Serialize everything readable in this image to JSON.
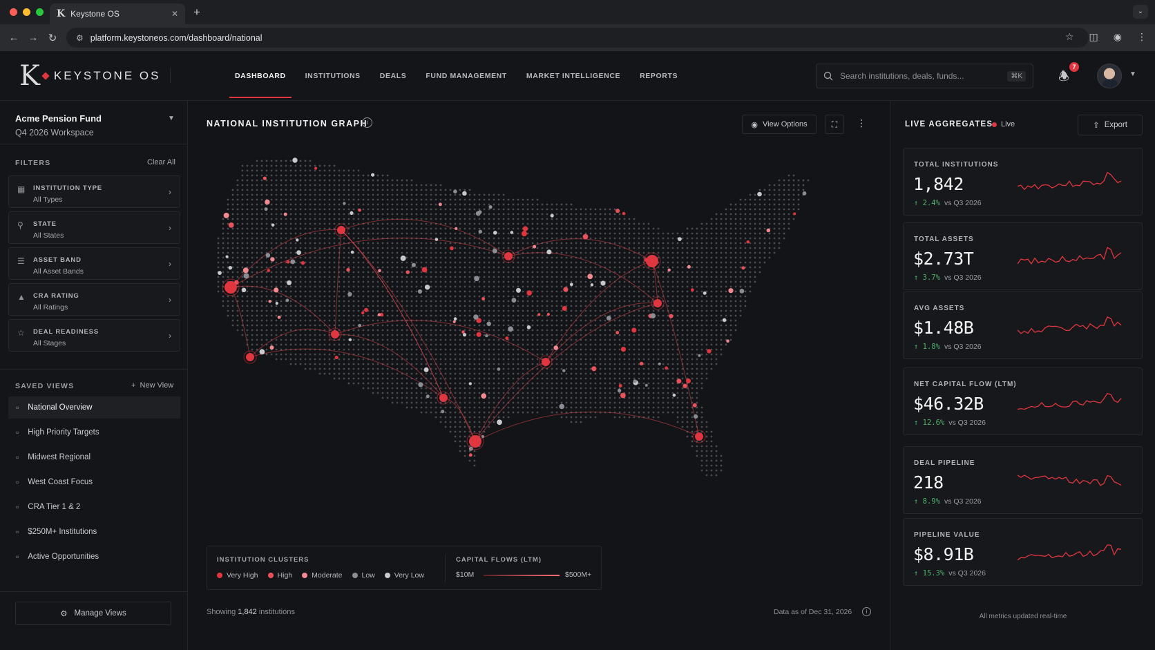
{
  "browser": {
    "tab_title": "Keystone OS",
    "tab_logo": "K",
    "tab_close": "✕",
    "new_tab": "+",
    "url": "platform.keystoneos.com/dashboard/national"
  },
  "header": {
    "logo_mark": "K",
    "brand": "KEYSTONE OS",
    "nav": [
      {
        "label": "DASHBOARD",
        "active": true
      },
      {
        "label": "INSTITUTIONS"
      },
      {
        "label": "DEALS"
      },
      {
        "label": "FUND MANAGEMENT"
      },
      {
        "label": "MARKET INTELLIGENCE"
      },
      {
        "label": "REPORTS"
      }
    ],
    "search_placeholder": "Search institutions, deals, funds...",
    "search_shortcut": "⌘K",
    "notification_count": "7"
  },
  "sidebar": {
    "workspace_name": "Acme Pension Fund",
    "workspace_sub": "Q4 2026 Workspace",
    "filters_title": "FILTERS",
    "clear_all": "Clear All",
    "filters": [
      {
        "label": "INSTITUTION TYPE",
        "value": "All Types",
        "icon": "building-icon"
      },
      {
        "label": "STATE",
        "value": "All States",
        "icon": "pin-icon"
      },
      {
        "label": "ASSET BAND",
        "value": "All Asset Bands",
        "icon": "list-icon"
      },
      {
        "label": "CRA RATING",
        "value": "All Ratings",
        "icon": "badge-icon"
      },
      {
        "label": "DEAL READINESS",
        "value": "All Stages",
        "icon": "star-icon"
      }
    ],
    "saved_title": "SAVED VIEWS",
    "new_view": "New View",
    "views": [
      {
        "label": "National Overview",
        "active": true
      },
      {
        "label": "High Priority Targets"
      },
      {
        "label": "Midwest Regional"
      },
      {
        "label": "West Coast Focus"
      },
      {
        "label": "CRA Tier 1 & 2"
      },
      {
        "label": "$250M+ Institutions"
      },
      {
        "label": "Active Opportunities"
      }
    ],
    "manage_views": "Manage Views"
  },
  "main": {
    "title": "NATIONAL INSTITUTION GRAPH",
    "info": "i",
    "view_options": "View Options",
    "legend": {
      "clusters_title": "INSTITUTION CLUSTERS",
      "clusters": [
        {
          "label": "Very High",
          "color": "#e0363f"
        },
        {
          "label": "High",
          "color": "#e8525a"
        },
        {
          "label": "Moderate",
          "color": "#f08a90"
        },
        {
          "label": "Low",
          "color": "#8a8d93"
        },
        {
          "label": "Very Low",
          "color": "#c7c9cd"
        }
      ],
      "flows_title": "CAPITAL FLOWS (LTM)",
      "flow_min": "$10M",
      "flow_max": "$500M+"
    },
    "showing_prefix": "Showing",
    "showing_count": "1,842",
    "showing_suffix": "institutions",
    "as_of": "Data as of Dec 31, 2026"
  },
  "right": {
    "title": "LIVE AGGREGATES",
    "live": "Live",
    "export": "Export",
    "cards": [
      {
        "label": "TOTAL INSTITUTIONS",
        "value": "1,842",
        "delta": "↑ 2.4%",
        "vs": "vs  Q3 2026"
      },
      {
        "label": "TOTAL ASSETS",
        "value": "$2.73T",
        "delta": "↑ 3.7%",
        "vs": "vs  Q3 2026"
      },
      {
        "label": "AVG ASSETS",
        "value": "$1.48B",
        "delta": "↑ 1.8%",
        "vs": "vs  Q3 2026"
      },
      {
        "label": "NET CAPITAL FLOW (LTM)",
        "value": "$46.32B",
        "delta": "↑ 12.6%",
        "vs": "vs  Q3 2026"
      },
      {
        "label": "DEAL PIPELINE",
        "value": "218",
        "delta": "↑ 8.9%",
        "vs": "vs  Q3 2026"
      },
      {
        "label": "PIPELINE VALUE",
        "value": "$8.91B",
        "delta": "↑ 15.3%",
        "vs": "vs  Q3 2026"
      }
    ],
    "updated": "All metrics updated real-time"
  },
  "colors": {
    "accent": "#e0363f",
    "positive": "#4cb36b"
  }
}
